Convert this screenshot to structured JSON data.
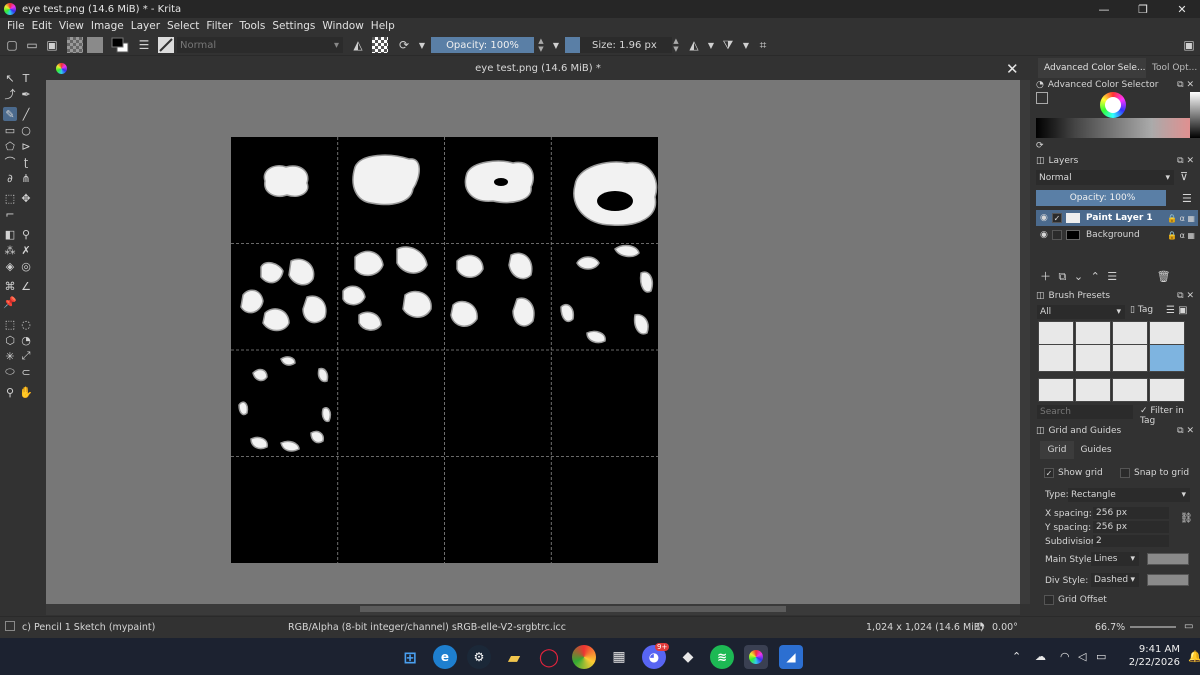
{
  "window": {
    "title": "eye test.png (14.6 MiB) * - Krita",
    "minimize_glyph": "—",
    "maximize_glyph": "❐",
    "close_glyph": "✕"
  },
  "menu": [
    "File",
    "Edit",
    "View",
    "Image",
    "Layer",
    "Select",
    "Filter",
    "Tools",
    "Settings",
    "Window",
    "Help"
  ],
  "toolbar": {
    "blend_mode": "Normal",
    "opacity": "Opacity: 100%",
    "size": "Size: 1.96 px"
  },
  "document": {
    "tab_title": "eye test.png (14.6 MiB) *",
    "close_glyph": "✕",
    "grid": {
      "columns": 4,
      "rows": 4
    }
  },
  "dock": {
    "tabs": [
      "Advanced Color Sele...",
      "Tool Opt..."
    ],
    "color_selector_title": "Advanced Color Selector",
    "layers": {
      "title": "Layers",
      "blend_mode": "Normal",
      "opacity": "Opacity: 100%",
      "items": [
        {
          "name": "Paint Layer 1",
          "selected": true
        },
        {
          "name": "Background",
          "selected": false
        }
      ]
    },
    "brush_presets": {
      "title": "Brush Presets",
      "filter": "All",
      "tag_label": "Tag",
      "search_placeholder": "Search",
      "filter_in_tag": "Filter in Tag"
    },
    "grid_guides": {
      "title": "Grid and Guides",
      "tabs": [
        "Grid",
        "Guides"
      ],
      "show_grid": "Show grid",
      "snap_to_grid": "Snap to grid",
      "type_label": "Type:",
      "type_value": "Rectangle",
      "x_spacing_label": "X spacing:",
      "x_spacing": "256 px",
      "y_spacing_label": "Y spacing:",
      "y_spacing": "256 px",
      "subdivision_label": "Subdivision:",
      "subdivision": "2",
      "main_style_label": "Main Style:",
      "main_style": "Lines",
      "div_style_label": "Div Style:",
      "div_style": "Dashed",
      "grid_offset": "Grid Offset"
    }
  },
  "status": {
    "brush": "c) Pencil 1 Sketch (mypaint)",
    "color_profile": "RGB/Alpha (8-bit integer/channel)  sRGB-elle-V2-srgbtrc.icc",
    "dimensions": "1,024 x 1,024 (14.6 MiB)",
    "rotation": "0.00°",
    "zoom": "66.7%"
  },
  "taskbar": {
    "time": "9:41 AM",
    "date": "2/22/2026",
    "discord_badge": "9+"
  }
}
